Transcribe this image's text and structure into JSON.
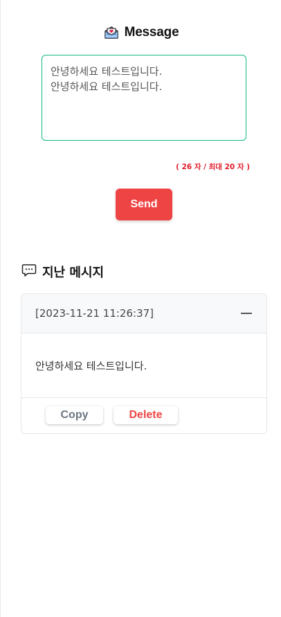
{
  "header": {
    "title": "Message",
    "icon": "envelope-heart-icon"
  },
  "message_input": {
    "value": "안녕하세요 테스트입니다.\n안녕하세요 테스트입니다."
  },
  "counter": {
    "text": "( 26 자 / 최대 20 자 )"
  },
  "send_button": {
    "label": "Send"
  },
  "history": {
    "title": "지난 메시지",
    "icon": "chat-bubble-icon",
    "items": [
      {
        "date": "[2023-11-21 11:26:37]",
        "text": "안녕하세요 테스트입니다.",
        "copy_label": "Copy",
        "delete_label": "Delete"
      }
    ]
  },
  "colors": {
    "accent_border": "#10b981",
    "send_bg": "#ef4444",
    "counter_text": "#e11d2a",
    "delete_text": "#ef4444"
  }
}
